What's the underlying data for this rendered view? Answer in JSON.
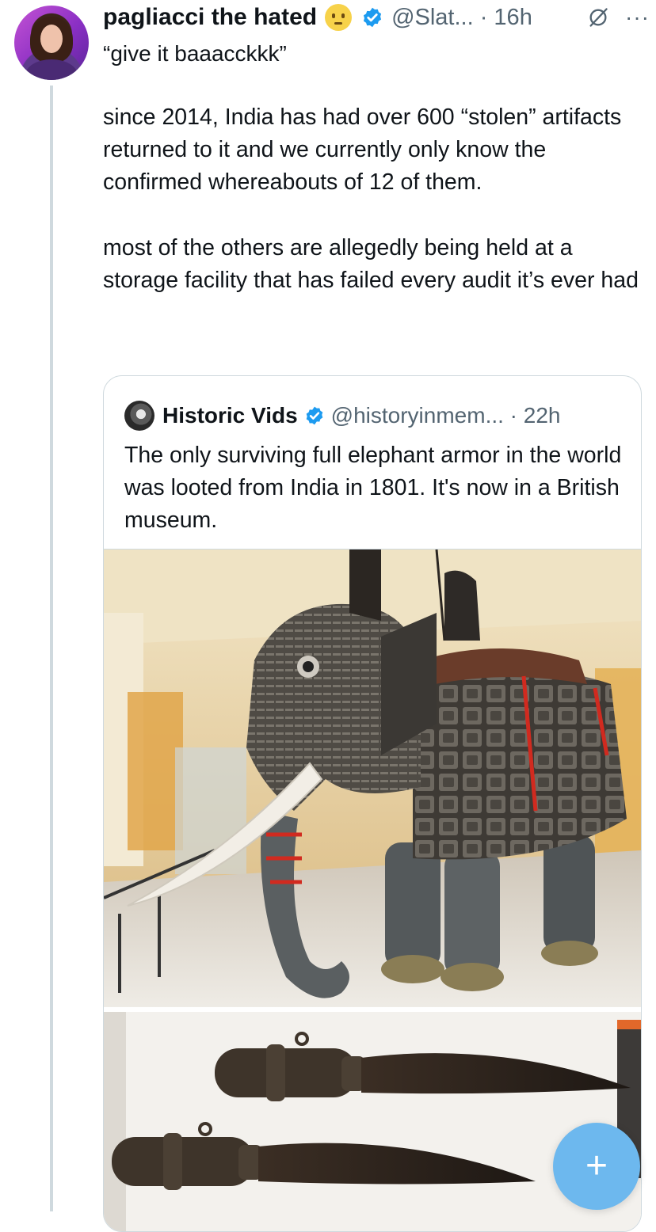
{
  "tweet": {
    "display_name": "pagliacci the hated",
    "handle_time": "@Slat... · 16h",
    "more": "···",
    "reply_text": "“give it baaacckkk”",
    "paragraphs": [
      "since 2014, India has had over 600 “stolen” artifacts returned to it and we currently only know the confirmed whereabouts of 12 of them.",
      "most of the others are allegedly being held at a storage facility that has failed every audit it’s ever had"
    ]
  },
  "quote": {
    "display_name": "Historic Vids",
    "handle_time": "@historyinmem... · 22h",
    "text": "The only surviving full elephant armor in the world was looted from India in 1801. It's now in a British museum."
  },
  "compose": {
    "label": "+"
  },
  "colors": {
    "accent": "#1d9bf0",
    "fab": "#6db8ee",
    "muted": "#536471",
    "border": "#cfd9de"
  },
  "icons": [
    "emoji-icon",
    "verified-badge-icon",
    "grok-icon",
    "more-icon",
    "plus-icon"
  ]
}
